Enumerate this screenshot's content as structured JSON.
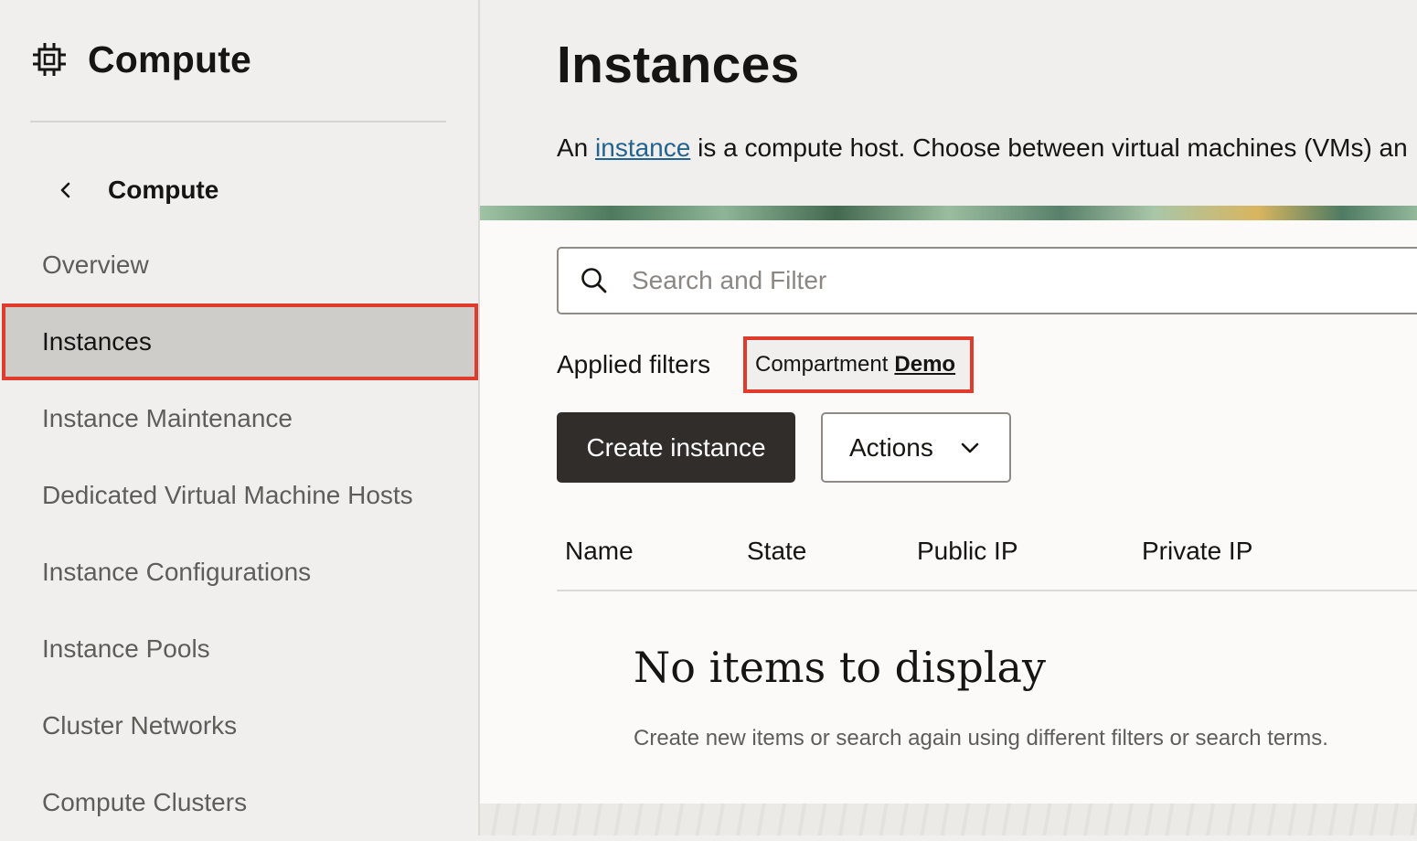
{
  "sidebar": {
    "brand_icon": "chip-icon",
    "brand_title": "Compute",
    "back_label": "Compute",
    "items": [
      {
        "label": "Overview"
      },
      {
        "label": "Instances",
        "active": true
      },
      {
        "label": "Instance Maintenance"
      },
      {
        "label": "Dedicated Virtual Machine Hosts"
      },
      {
        "label": "Instance Configurations"
      },
      {
        "label": "Instance Pools"
      },
      {
        "label": "Cluster Networks"
      },
      {
        "label": "Compute Clusters"
      }
    ]
  },
  "main": {
    "title": "Instances",
    "intro_prefix": "An",
    "intro_link": "instance",
    "intro_suffix": "is a compute host. Choose between virtual machines (VMs) an",
    "search_placeholder": "Search and Filter",
    "applied_filters_label": "Applied filters",
    "filter_chip": {
      "key": "Compartment",
      "value": "Demo"
    },
    "create_button": "Create instance",
    "actions_button": "Actions",
    "columns": [
      "Name",
      "State",
      "Public IP",
      "Private IP"
    ],
    "empty_title": "No items to display",
    "empty_subtitle": "Create new items or search again using different filters or search terms."
  },
  "colors": {
    "accent_highlight": "#e03c2e",
    "primary_button": "#312d2a",
    "link": "#22648f"
  }
}
